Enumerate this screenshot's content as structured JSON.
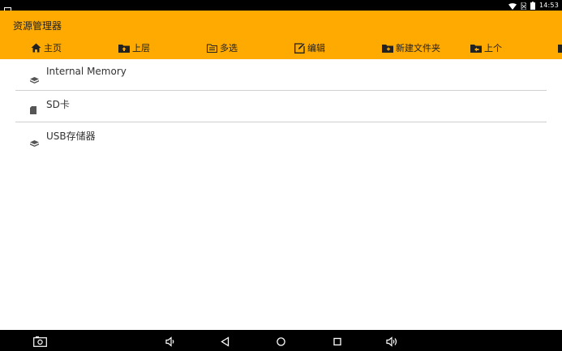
{
  "status_bar": {
    "time": "14:53"
  },
  "app": {
    "title": "资源管理器"
  },
  "toolbar": {
    "home": "主页",
    "up": "上层",
    "multi_select": "多选",
    "edit": "编辑",
    "new_folder": "新建文件夹",
    "previous": "上个"
  },
  "storage_list": [
    {
      "label": "Internal Memory",
      "icon": "layers-icon"
    },
    {
      "label": "SD卡",
      "icon": "sd-card-icon"
    },
    {
      "label": "USB存储器",
      "icon": "layers-icon"
    }
  ],
  "colors": {
    "accent": "#ffaa00",
    "bars": "#000000"
  }
}
